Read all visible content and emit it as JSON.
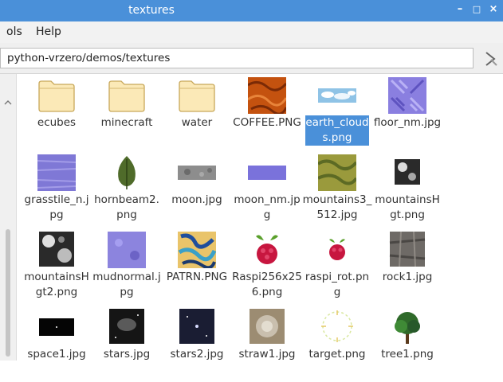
{
  "window": {
    "title": "textures",
    "min_icon": "minimize-icon",
    "max_icon": "maximize-icon",
    "close_icon": "close-icon"
  },
  "menubar": {
    "items": [
      "ols",
      "Help"
    ]
  },
  "location": {
    "path": "python-vrzero/demos/textures"
  },
  "files": [
    {
      "name": "ecubes",
      "kind": "folder"
    },
    {
      "name": "minecraft",
      "kind": "folder"
    },
    {
      "name": "water",
      "kind": "folder"
    },
    {
      "name": "COFFEE.PNG",
      "kind": "image"
    },
    {
      "name": "earth_clouds.png",
      "kind": "image",
      "selected": true
    },
    {
      "name": "floor_nm.jpg",
      "kind": "image"
    },
    {
      "name": "grasstile_n.jpg",
      "kind": "image"
    },
    {
      "name": "hornbeam2.png",
      "kind": "image"
    },
    {
      "name": "moon.jpg",
      "kind": "image"
    },
    {
      "name": "moon_nm.jpg",
      "kind": "image"
    },
    {
      "name": "mountains3_512.jpg",
      "kind": "image"
    },
    {
      "name": "mountainsHgt.png",
      "kind": "image"
    },
    {
      "name": "mountainsHgt2.png",
      "kind": "image"
    },
    {
      "name": "mudnormal.jpg",
      "kind": "image"
    },
    {
      "name": "PATRN.PNG",
      "kind": "image"
    },
    {
      "name": "Raspi256x256.png",
      "kind": "image"
    },
    {
      "name": "raspi_rot.png",
      "kind": "image"
    },
    {
      "name": "rock1.jpg",
      "kind": "image"
    },
    {
      "name": "space1.jpg",
      "kind": "image"
    },
    {
      "name": "stars.jpg",
      "kind": "image"
    },
    {
      "name": "stars2.jpg",
      "kind": "image"
    },
    {
      "name": "straw1.jpg",
      "kind": "image"
    },
    {
      "name": "target.png",
      "kind": "image"
    },
    {
      "name": "tree1.png",
      "kind": "image"
    }
  ],
  "colors": {
    "titlebar": "#4a90d9",
    "selection": "#4a90d9",
    "folder": "#fbe9b7"
  }
}
